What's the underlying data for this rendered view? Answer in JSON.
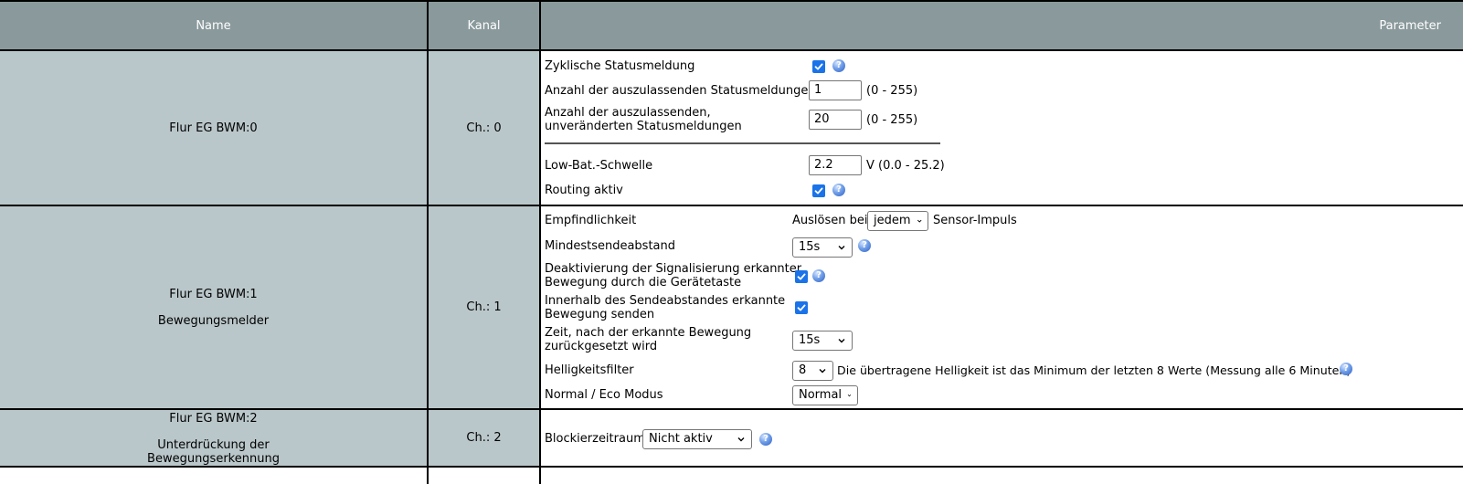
{
  "header": {
    "name": "Name",
    "channel": "Kanal",
    "params": "Parameter"
  },
  "rows": [
    {
      "name": "Flur EG BWM:0",
      "channel": "Ch.: 0",
      "params": {
        "cyclic_status": {
          "label": "Zyklische Statusmeldung",
          "checked": true
        },
        "skip_status": {
          "label": "Anzahl der auszulassenden Statusmeldungen",
          "value": "1",
          "range": "(0 - 255)"
        },
        "skip_unchanged": {
          "label_line1": "Anzahl der auszulassenden,",
          "label_line2": "unveränderten Statusmeldungen",
          "value": "20",
          "range": "(0 - 255)"
        },
        "lowbat": {
          "label": "Low-Bat.-Schwelle",
          "value": "2.2",
          "range": "V (0.0 - 25.2)"
        },
        "routing": {
          "label": "Routing aktiv",
          "checked": true
        }
      }
    },
    {
      "name": "Flur EG BWM:1",
      "subname": "Bewegungsmelder",
      "channel": "Ch.: 1",
      "params": {
        "sensitivity": {
          "label": "Empfindlichkeit",
          "prefix": "Auslösen bei",
          "value": "jedem",
          "suffix": "Sensor-Impuls"
        },
        "min_interval": {
          "label": "Mindestsendeabstand",
          "value": "15s"
        },
        "deactivate_signal": {
          "label_line1": "Deaktivierung der Signalisierung erkannter",
          "label_line2": "Bewegung durch die Gerätetaste",
          "checked": true
        },
        "within_interval": {
          "label_line1": "Innerhalb des Sendeabstandes erkannte",
          "label_line2": "Bewegung senden",
          "checked": true
        },
        "reset_time": {
          "label_line1": "Zeit, nach der erkannte Bewegung",
          "label_line2": "zurückgesetzt wird",
          "value": "15s"
        },
        "brightness_filter": {
          "label": "Helligkeitsfilter",
          "value": "8",
          "description": "Die übertragene Helligkeit ist das Minimum der letzten 8 Werte (Messung alle 6 Minuten)"
        },
        "eco_mode": {
          "label": "Normal / Eco Modus",
          "value": "Normal"
        }
      }
    },
    {
      "name": "Flur EG BWM:2",
      "subname_line1": "Unterdrückung der",
      "subname_line2": "Bewegungserkennung",
      "channel": "Ch.: 2",
      "params": {
        "block_period": {
          "label": "Blockierzeitraum",
          "value": "Nicht aktiv"
        }
      }
    }
  ],
  "colors": {
    "header_bg": "#8a999c",
    "cell_bg": "#bac7ca",
    "checkbox": "#1a73e8",
    "border": "#000000"
  },
  "icons": {
    "help": "help-icon",
    "check": "checkmark-icon",
    "chevron": "chevron-down-icon"
  }
}
